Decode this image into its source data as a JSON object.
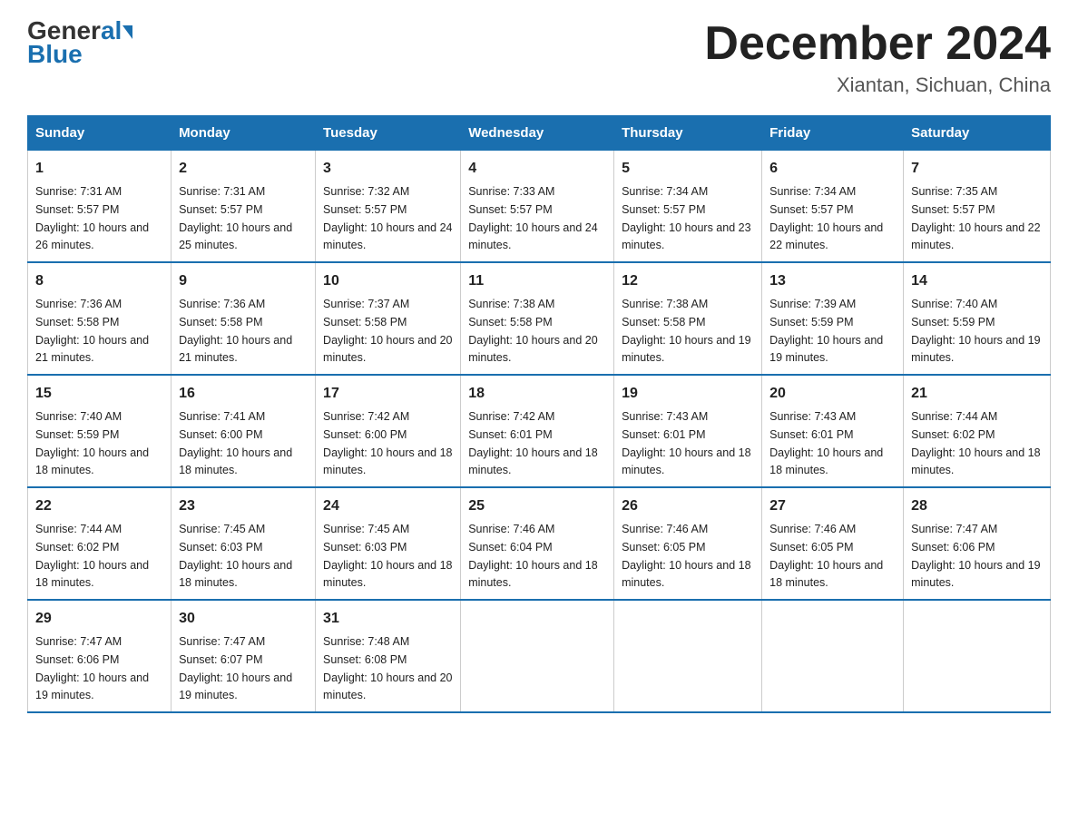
{
  "header": {
    "logo_general": "General",
    "logo_blue": "Blue",
    "month_title": "December 2024",
    "location": "Xiantan, Sichuan, China"
  },
  "weekdays": [
    "Sunday",
    "Monday",
    "Tuesday",
    "Wednesday",
    "Thursday",
    "Friday",
    "Saturday"
  ],
  "weeks": [
    [
      {
        "day": "1",
        "sunrise": "7:31 AM",
        "sunset": "5:57 PM",
        "daylight": "10 hours and 26 minutes."
      },
      {
        "day": "2",
        "sunrise": "7:31 AM",
        "sunset": "5:57 PM",
        "daylight": "10 hours and 25 minutes."
      },
      {
        "day": "3",
        "sunrise": "7:32 AM",
        "sunset": "5:57 PM",
        "daylight": "10 hours and 24 minutes."
      },
      {
        "day": "4",
        "sunrise": "7:33 AM",
        "sunset": "5:57 PM",
        "daylight": "10 hours and 24 minutes."
      },
      {
        "day": "5",
        "sunrise": "7:34 AM",
        "sunset": "5:57 PM",
        "daylight": "10 hours and 23 minutes."
      },
      {
        "day": "6",
        "sunrise": "7:34 AM",
        "sunset": "5:57 PM",
        "daylight": "10 hours and 22 minutes."
      },
      {
        "day": "7",
        "sunrise": "7:35 AM",
        "sunset": "5:57 PM",
        "daylight": "10 hours and 22 minutes."
      }
    ],
    [
      {
        "day": "8",
        "sunrise": "7:36 AM",
        "sunset": "5:58 PM",
        "daylight": "10 hours and 21 minutes."
      },
      {
        "day": "9",
        "sunrise": "7:36 AM",
        "sunset": "5:58 PM",
        "daylight": "10 hours and 21 minutes."
      },
      {
        "day": "10",
        "sunrise": "7:37 AM",
        "sunset": "5:58 PM",
        "daylight": "10 hours and 20 minutes."
      },
      {
        "day": "11",
        "sunrise": "7:38 AM",
        "sunset": "5:58 PM",
        "daylight": "10 hours and 20 minutes."
      },
      {
        "day": "12",
        "sunrise": "7:38 AM",
        "sunset": "5:58 PM",
        "daylight": "10 hours and 19 minutes."
      },
      {
        "day": "13",
        "sunrise": "7:39 AM",
        "sunset": "5:59 PM",
        "daylight": "10 hours and 19 minutes."
      },
      {
        "day": "14",
        "sunrise": "7:40 AM",
        "sunset": "5:59 PM",
        "daylight": "10 hours and 19 minutes."
      }
    ],
    [
      {
        "day": "15",
        "sunrise": "7:40 AM",
        "sunset": "5:59 PM",
        "daylight": "10 hours and 18 minutes."
      },
      {
        "day": "16",
        "sunrise": "7:41 AM",
        "sunset": "6:00 PM",
        "daylight": "10 hours and 18 minutes."
      },
      {
        "day": "17",
        "sunrise": "7:42 AM",
        "sunset": "6:00 PM",
        "daylight": "10 hours and 18 minutes."
      },
      {
        "day": "18",
        "sunrise": "7:42 AM",
        "sunset": "6:01 PM",
        "daylight": "10 hours and 18 minutes."
      },
      {
        "day": "19",
        "sunrise": "7:43 AM",
        "sunset": "6:01 PM",
        "daylight": "10 hours and 18 minutes."
      },
      {
        "day": "20",
        "sunrise": "7:43 AM",
        "sunset": "6:01 PM",
        "daylight": "10 hours and 18 minutes."
      },
      {
        "day": "21",
        "sunrise": "7:44 AM",
        "sunset": "6:02 PM",
        "daylight": "10 hours and 18 minutes."
      }
    ],
    [
      {
        "day": "22",
        "sunrise": "7:44 AM",
        "sunset": "6:02 PM",
        "daylight": "10 hours and 18 minutes."
      },
      {
        "day": "23",
        "sunrise": "7:45 AM",
        "sunset": "6:03 PM",
        "daylight": "10 hours and 18 minutes."
      },
      {
        "day": "24",
        "sunrise": "7:45 AM",
        "sunset": "6:03 PM",
        "daylight": "10 hours and 18 minutes."
      },
      {
        "day": "25",
        "sunrise": "7:46 AM",
        "sunset": "6:04 PM",
        "daylight": "10 hours and 18 minutes."
      },
      {
        "day": "26",
        "sunrise": "7:46 AM",
        "sunset": "6:05 PM",
        "daylight": "10 hours and 18 minutes."
      },
      {
        "day": "27",
        "sunrise": "7:46 AM",
        "sunset": "6:05 PM",
        "daylight": "10 hours and 18 minutes."
      },
      {
        "day": "28",
        "sunrise": "7:47 AM",
        "sunset": "6:06 PM",
        "daylight": "10 hours and 19 minutes."
      }
    ],
    [
      {
        "day": "29",
        "sunrise": "7:47 AM",
        "sunset": "6:06 PM",
        "daylight": "10 hours and 19 minutes."
      },
      {
        "day": "30",
        "sunrise": "7:47 AM",
        "sunset": "6:07 PM",
        "daylight": "10 hours and 19 minutes."
      },
      {
        "day": "31",
        "sunrise": "7:48 AM",
        "sunset": "6:08 PM",
        "daylight": "10 hours and 20 minutes."
      },
      null,
      null,
      null,
      null
    ]
  ]
}
